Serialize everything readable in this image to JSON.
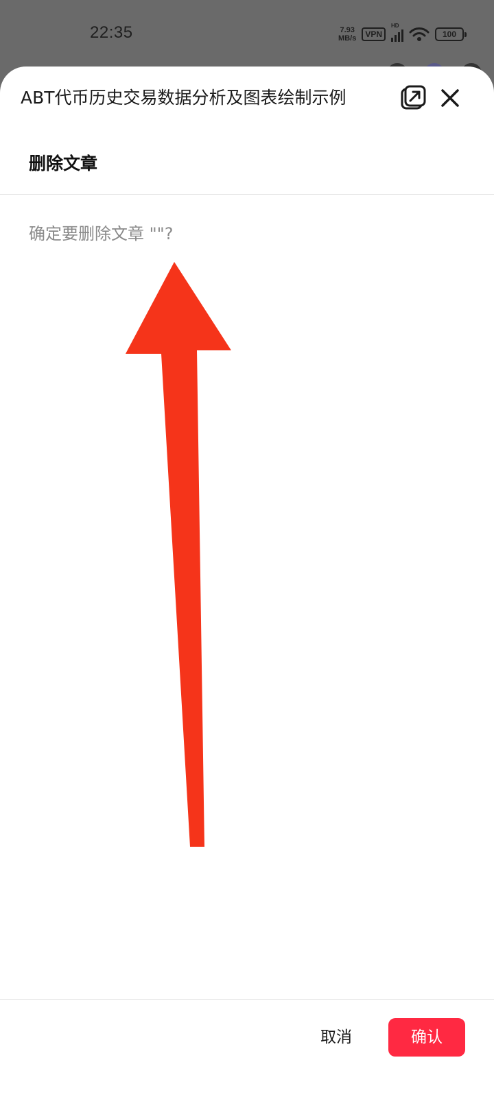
{
  "status_bar": {
    "time": "22:35",
    "net_speed_value": "7.93",
    "net_speed_unit": "MB/s",
    "vpn_label": "VPN",
    "hd_label": "HD",
    "battery_level": "100"
  },
  "sheet": {
    "title": "ABT代币历史交易数据分析及图表绘制示例"
  },
  "dialog": {
    "title": "删除文章",
    "message": "确定要删除文章 \"\"?",
    "cancel_label": "取消",
    "confirm_label": "确认"
  },
  "colors": {
    "accent": "#ff2942",
    "annotation_arrow": "#f5341a",
    "overlay": "#6a6a6a"
  }
}
